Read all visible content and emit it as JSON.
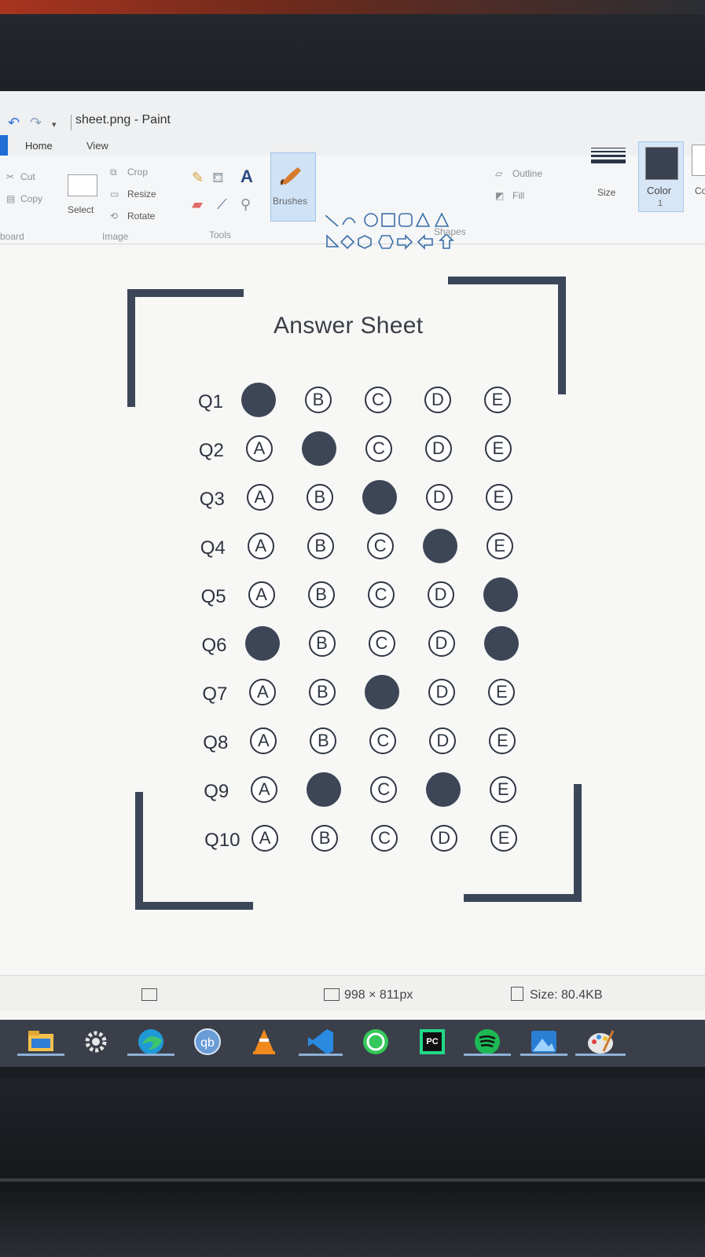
{
  "window": {
    "title": "sheet.png - Paint",
    "tabs": [
      "Home",
      "View"
    ]
  },
  "ribbon": {
    "clipboard": {
      "cut": "Cut",
      "copy": "Copy",
      "group": "board"
    },
    "image": {
      "select": "Select",
      "crop": "Crop",
      "resize": "Resize",
      "rotate": "Rotate",
      "group": "Image"
    },
    "tools": {
      "text_tool": "A",
      "group": "Tools"
    },
    "brushes": {
      "label": "Brushes"
    },
    "shapes": {
      "outline": "Outline",
      "fill": "Fill",
      "group": "Shapes"
    },
    "size": {
      "label": "Size"
    },
    "color1": {
      "label": "Color",
      "number": "1",
      "value": "#3a4150"
    },
    "color2": {
      "label": "Co"
    }
  },
  "sheet": {
    "title": "Answer Sheet",
    "options": [
      "A",
      "B",
      "C",
      "D",
      "E"
    ],
    "questions": [
      {
        "label": "Q1",
        "filled": [
          "A"
        ]
      },
      {
        "label": "Q2",
        "filled": [
          "B"
        ]
      },
      {
        "label": "Q3",
        "filled": [
          "C"
        ]
      },
      {
        "label": "Q4",
        "filled": [
          "D"
        ]
      },
      {
        "label": "Q5",
        "filled": [
          "E"
        ]
      },
      {
        "label": "Q6",
        "filled": [
          "A",
          "E"
        ]
      },
      {
        "label": "Q7",
        "filled": [
          "C"
        ]
      },
      {
        "label": "Q8",
        "filled": []
      },
      {
        "label": "Q9",
        "filled": [
          "B",
          "D"
        ]
      },
      {
        "label": "Q10",
        "filled": []
      }
    ],
    "mark_color": "#3d4656"
  },
  "statusbar": {
    "dimensions": "998 × 811px",
    "size": "Size: 80.4KB"
  },
  "taskbar": {
    "apps": [
      "file-explorer-icon",
      "settings-icon",
      "edge-icon",
      "qbittorrent-icon",
      "vlc-icon",
      "vscode-icon",
      "whatsapp-icon",
      "pycharm-icon",
      "spotify-icon",
      "photos-icon",
      "paint-icon"
    ]
  }
}
